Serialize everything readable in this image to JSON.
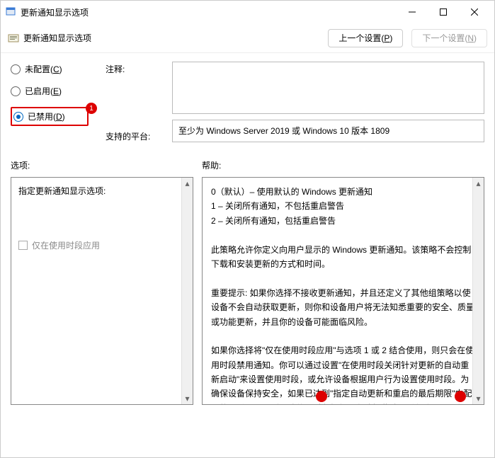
{
  "window": {
    "title": "更新通知显示选项"
  },
  "header": {
    "title": "更新通知显示选项",
    "prev_btn": "上一个设置(P)",
    "next_btn": "下一个设置(N)"
  },
  "radios": {
    "not_configured": "未配置(C)",
    "enabled": "已启用(E)",
    "disabled": "已禁用(D)",
    "disabled_badge": "1"
  },
  "side": {
    "comment": "注释:",
    "supported": "支持的平台:"
  },
  "platform_text": "至少为 Windows Server 2019 或 Windows 10 版本 1809",
  "labels": {
    "options": "选项:",
    "help": "帮助:"
  },
  "left_pane": {
    "title": "指定更新通知显示选项:",
    "checkbox_label": "仅在使用时段应用"
  },
  "help_text": "0（默认）– 使用默认的 Windows 更新通知\n1 – 关闭所有通知，不包括重启警告\n2 – 关闭所有通知，包括重启警告\n\n此策略允许你定义向用户显示的 Windows 更新通知。该策略不会控制下载和安装更新的方式和时间。\n\n重要提示: 如果你选择不接收更新通知，并且还定义了其他组策略以使设备不会自动获取更新，则你和设备用户将无法知悉重要的安全、质量或功能更新，并且你的设备可能面临风险。\n\n如果你选择将\"仅在使用时段应用\"与选项 1 或 2 结合使用，则只会在使用时段禁用通知。你可以通过设置\"在使用时段关闭针对更新的自动重新启动\"来设置使用时段，或允许设备根据用户行为设置使用时段。为确保设备保持安全，如果已达到\"指定自动更新和重启的最后期限\"中配置的最后期限，则无论使用时段如何，在选择此选项后都会显示通知。"
}
